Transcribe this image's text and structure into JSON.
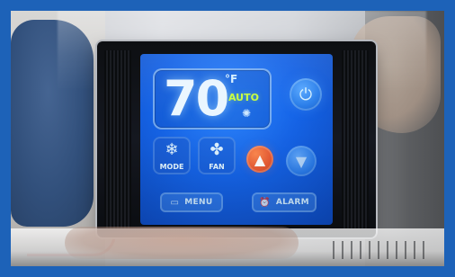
{
  "thermostat": {
    "temperature": "70",
    "unit": "°F",
    "mode_status": "AUTO",
    "buttons": {
      "mode": "MODE",
      "fan": "FAN",
      "menu": "MENU",
      "alarm": "ALARM"
    }
  },
  "icons": {
    "power": "power-icon",
    "mode": "snowflake-icon",
    "fan": "fan-icon",
    "up": "up-arrow-icon",
    "down": "down-arrow-icon",
    "menu": "menu-icon",
    "alarm": "alarm-icon"
  },
  "colors": {
    "frame_blue": "#1d62b8",
    "screen_blue": "#1563e6",
    "auto_green": "#c8ff3f",
    "up_orange": "#e85a34"
  }
}
